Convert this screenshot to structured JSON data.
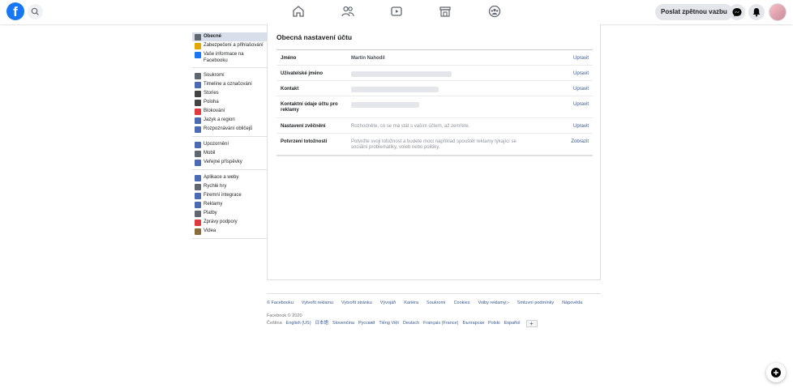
{
  "topbar": {
    "logo_letter": "f",
    "feedback_label": "Poslat zpětnou vazbu",
    "nav_icons": [
      "home-icon",
      "friends-icon",
      "watch-icon",
      "marketplace-icon",
      "groups-icon"
    ],
    "right_icons": [
      "messenger-icon",
      "notifications-icon"
    ]
  },
  "sidebar": {
    "groups": [
      [
        {
          "label": "Obecné",
          "icon": "gear-icon",
          "active": true
        },
        {
          "label": "Zabezpečení a přihlašování",
          "icon": "shield-icon"
        },
        {
          "label": "Vaše informace na Facebooku",
          "icon": "facebook-icon"
        }
      ],
      [
        {
          "label": "Soukromí",
          "icon": "lock-icon"
        },
        {
          "label": "Timeline a označování",
          "icon": "timeline-icon"
        },
        {
          "label": "Stories",
          "icon": "book-icon"
        },
        {
          "label": "Poloha",
          "icon": "location-icon"
        },
        {
          "label": "Blokování",
          "icon": "block-icon"
        },
        {
          "label": "Jazyk a region",
          "icon": "language-icon"
        },
        {
          "label": "Rozpoznávání obličejů",
          "icon": "face-icon"
        }
      ],
      [
        {
          "label": "Upozornění",
          "icon": "globe-icon"
        },
        {
          "label": "Mobil",
          "icon": "mobile-icon"
        },
        {
          "label": "Veřejné příspěvky",
          "icon": "rss-icon"
        }
      ],
      [
        {
          "label": "Aplikace a weby",
          "icon": "apps-icon"
        },
        {
          "label": "Rychlé hry",
          "icon": "gamepad-icon"
        },
        {
          "label": "Firemní integrace",
          "icon": "business-icon"
        },
        {
          "label": "Reklamy",
          "icon": "ads-icon"
        },
        {
          "label": "Platby",
          "icon": "card-icon"
        },
        {
          "label": "Zprávy podpory",
          "icon": "support-icon"
        },
        {
          "label": "Videa",
          "icon": "film-icon"
        }
      ]
    ]
  },
  "main": {
    "title": "Obecná nastavení účtu",
    "rows": [
      {
        "label": "Jméno",
        "value": "Martin Nahodil",
        "action": "Upravit"
      },
      {
        "label": "Uživatelské jméno",
        "value": "",
        "action": "Upravit"
      },
      {
        "label": "Kontakt",
        "value": "",
        "action": "Upravit"
      },
      {
        "label": "Kontaktní údaje účtu pro reklamy",
        "value": "",
        "action": "Upravit"
      },
      {
        "label": "Nastavení zvěčnění",
        "value": "Rozhodněte, co se má stát s vaším účtem, až zemřete.",
        "action": "Upravit"
      },
      {
        "label": "Potvrzení totožnosti",
        "value": "Potvrďte svoji totožnost a budete moct například spouštět reklamy týkající se sociální problematiky, voleb nebo politiky.",
        "action": "Zobrazit"
      }
    ]
  },
  "footer": {
    "links": [
      "© Facebooku",
      "Vytvořit reklamu",
      "Vytvořit stránku",
      "Vývojáři",
      "Kariéra",
      "Soukromí",
      "Cookies",
      "Volby reklamy▷",
      "Smluvní podmínky",
      "Nápověda"
    ],
    "copyright": "Facebook © 2020",
    "languages": [
      "Čeština",
      "English (US)",
      "日本語",
      "Slovenčina",
      "Русский",
      "Tiếng Việt",
      "Deutsch",
      "Français (France)",
      "Български",
      "Polski",
      "Español"
    ],
    "more_languages": "+"
  }
}
